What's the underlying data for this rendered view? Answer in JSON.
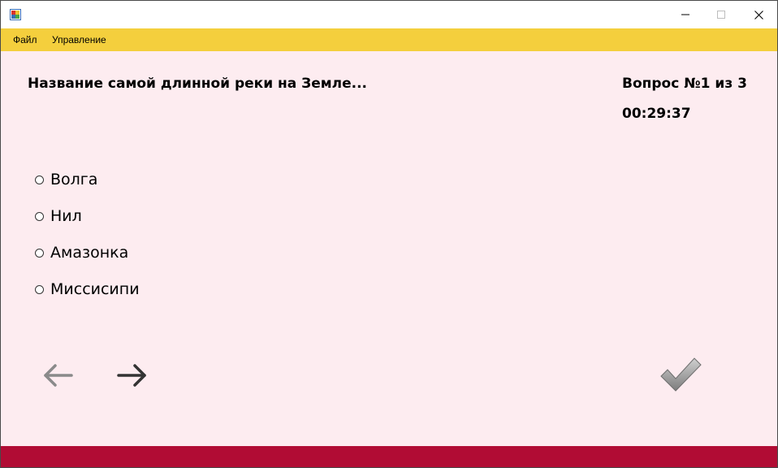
{
  "window": {
    "title": "",
    "controls": [
      "minimize",
      "maximize",
      "close"
    ]
  },
  "menu": {
    "file": "Файл",
    "manage": "Управление"
  },
  "quiz": {
    "question": "Название самой длинной реки на Земле...",
    "question_number": "Вопрос №1 из 3",
    "timer": "00:29:37",
    "options": [
      "Волга",
      "Нил",
      "Амазонка",
      "Миссисипи"
    ],
    "selected": null
  },
  "icons": {
    "prev": "arrow-left-icon",
    "next": "arrow-right-icon",
    "submit": "checkmark-icon",
    "app": "app-window-icon"
  },
  "colors": {
    "menubar": "#f4cf3d",
    "content_background": "#fdecf0",
    "bottom_bar": "#b10c34"
  }
}
